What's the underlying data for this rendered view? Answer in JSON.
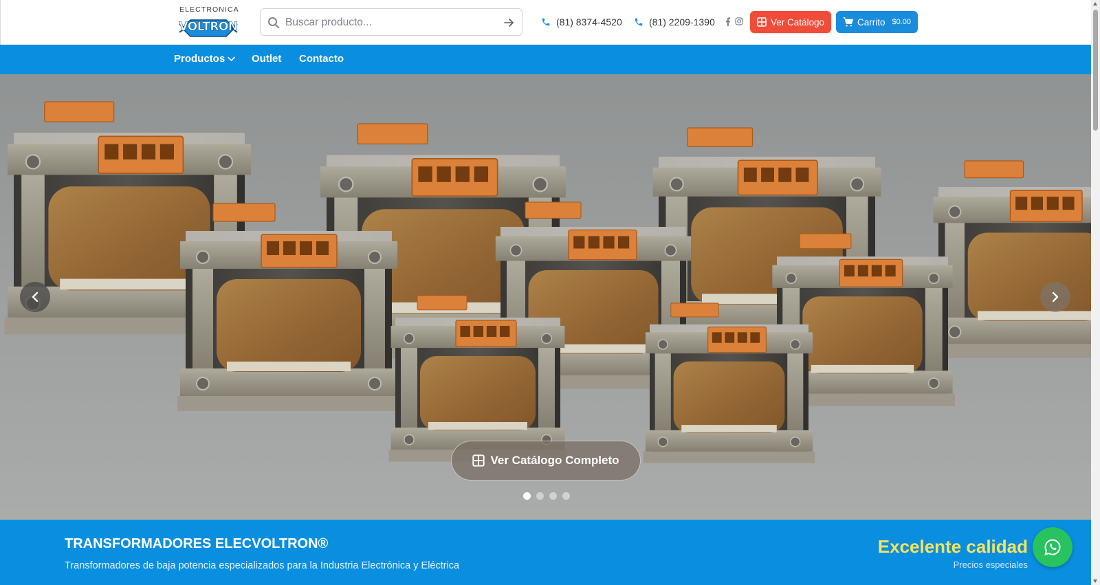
{
  "header": {
    "logo": {
      "top_text": "ELECTRONICA",
      "word": "VOLTRON",
      "icon": "voltron-logo"
    },
    "search": {
      "placeholder": "Buscar producto...",
      "value": "",
      "icon": "search-icon",
      "submit_icon": "arrow-right-icon"
    },
    "phones": [
      {
        "label": "(81) 8374-4520",
        "icon": "phone-icon"
      },
      {
        "label": "(81) 2209-1390",
        "icon": "phone-icon"
      }
    ],
    "social": [
      {
        "icon": "facebook-icon"
      },
      {
        "icon": "instagram-icon"
      }
    ],
    "catalog_button": {
      "label": "Ver Catálogo",
      "icon": "grid-icon",
      "color": "#f04c3a"
    },
    "cart_button": {
      "label": "Carrito",
      "amount": "$0.00",
      "icon": "cart-icon",
      "color": "#1a8cdc"
    }
  },
  "nav": {
    "items": [
      {
        "label": "Productos",
        "icon": "chevron-down-icon"
      },
      {
        "label": "Outlet"
      },
      {
        "label": "Contacto"
      }
    ],
    "color": "#0a8fe0"
  },
  "hero": {
    "cta_label": "Ver Catálogo Completo",
    "cta_icon": "grid-icon",
    "prev_icon": "chevron-left-icon",
    "next_icon": "chevron-right-icon",
    "slides": 4,
    "active_slide": 1
  },
  "banner": {
    "title": "TRANSFORMADORES ELECVOLTRON®",
    "subtitle": "Transformadores de baja potencia especializados para la Industria Electrónica y Eléctrica",
    "quality": "Excelente calidad",
    "quality_sub": "Precios especiales",
    "quality_color": "#f6e35c"
  },
  "whatsapp": {
    "icon": "whatsapp-icon",
    "color": "#28c25e"
  }
}
